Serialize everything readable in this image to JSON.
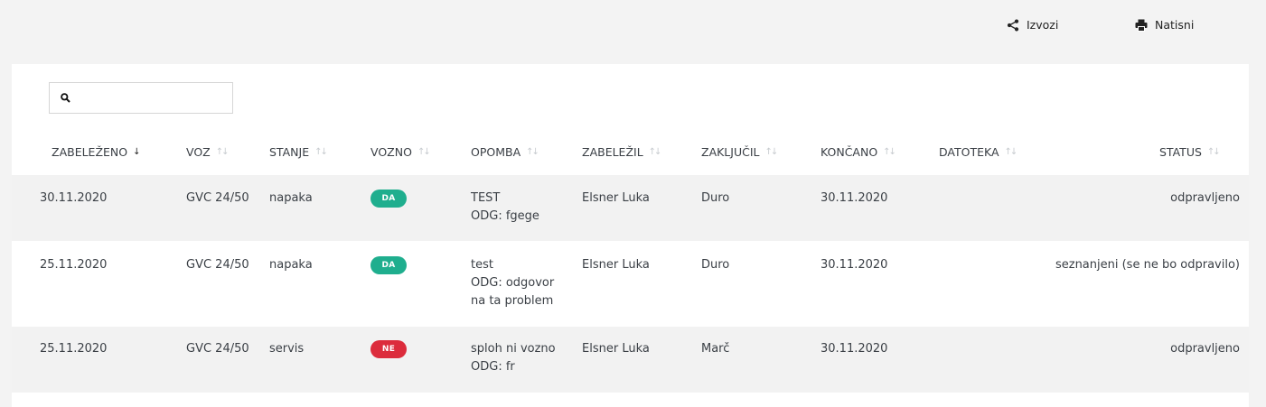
{
  "toolbar": {
    "export_label": "Izvozi",
    "print_label": "Natisni"
  },
  "search": {
    "value": "",
    "placeholder": ""
  },
  "table": {
    "columns": [
      "ZABELEŽENO",
      "VOZ",
      "STANJE",
      "VOZNO",
      "OPOMBA",
      "ZABELEŽIL",
      "ZAKLJUČIL",
      "KONČANO",
      "DATOTEKA",
      "STATUS"
    ],
    "sorted_column": "ZABELEŽENO",
    "sort_direction": "descending",
    "rows": [
      {
        "zabelezeno": "30.11.2020",
        "voz": "GVC 24/50",
        "stanje": "napaka",
        "vozno": "DA",
        "opomba": [
          "TEST",
          "ODG: fgege"
        ],
        "zabelezil": "Elsner Luka",
        "zakljucil": "Duro",
        "koncano": "30.11.2020",
        "datoteka": "",
        "status": "odpravljeno"
      },
      {
        "zabelezeno": "25.11.2020",
        "voz": "GVC 24/50",
        "stanje": "napaka",
        "vozno": "DA",
        "opomba": [
          "test",
          "ODG: odgovor",
          "na ta problem"
        ],
        "zabelezil": "Elsner Luka",
        "zakljucil": "Duro",
        "koncano": "30.11.2020",
        "datoteka": "",
        "status": "seznanjeni (se ne bo odpravilo)"
      },
      {
        "zabelezeno": "25.11.2020",
        "voz": "GVC 24/50",
        "stanje": "servis",
        "vozno": "NE",
        "opomba": [
          "sploh ni vozno",
          "ODG: fr"
        ],
        "zabelezil": "Elsner Luka",
        "zakljucil": "Marč",
        "koncano": "30.11.2020",
        "datoteka": "",
        "status": "odpravljeno"
      }
    ]
  },
  "colors": {
    "badge_da": "#1fae8e",
    "badge_ne": "#dc2c3c",
    "row_shade": "#f2f2f2",
    "background": "#f3f3f3"
  },
  "icons": {
    "export": "share-icon",
    "print": "printer-icon",
    "search": "search-icon",
    "sort": "sort-arrows-icon"
  }
}
